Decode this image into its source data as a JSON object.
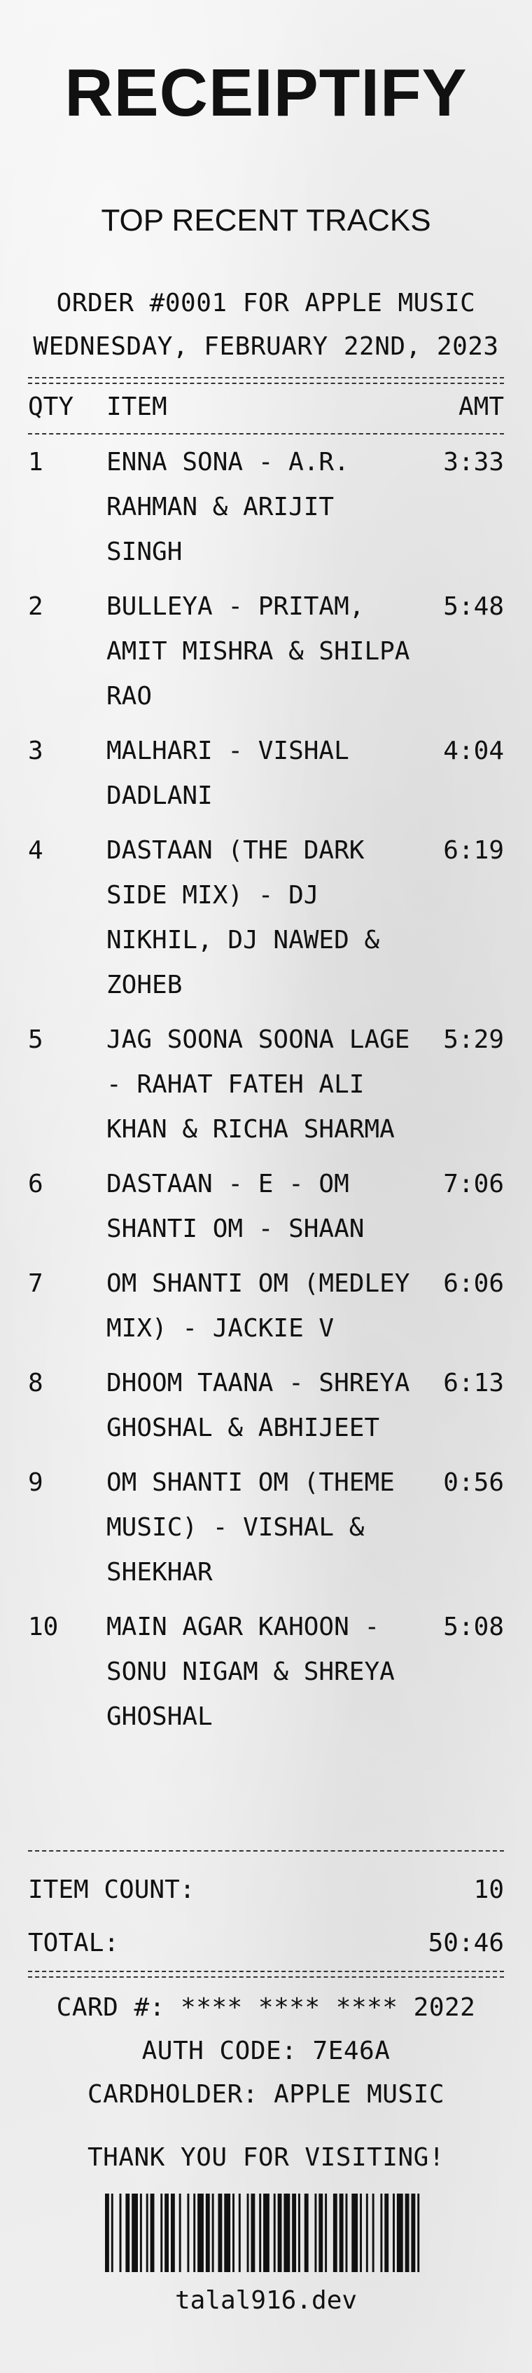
{
  "brand": "RECEIPTIFY",
  "subtitle": "TOP RECENT TRACKS",
  "order_line": "ORDER #0001 FOR APPLE MUSIC",
  "date_line": "WEDNESDAY, FEBRUARY 22ND, 2023",
  "columns": {
    "qty": "QTY",
    "item": "ITEM",
    "amt": "AMT"
  },
  "tracks": [
    {
      "qty": "1",
      "item": "ENNA SONA - A.R. RAHMAN & ARIJIT SINGH",
      "amt": "3:33"
    },
    {
      "qty": "2",
      "item": "BULLEYA - PRITAM, AMIT MISHRA & SHILPA RAO",
      "amt": "5:48"
    },
    {
      "qty": "3",
      "item": "MALHARI - VISHAL DADLANI",
      "amt": "4:04"
    },
    {
      "qty": "4",
      "item": "DASTAAN (THE DARK SIDE MIX) - DJ NIKHIL, DJ NAWED & ZOHEB",
      "amt": "6:19"
    },
    {
      "qty": "5",
      "item": "JAG SOONA SOONA LAGE - RAHAT FATEH ALI KHAN & RICHA SHARMA",
      "amt": "5:29"
    },
    {
      "qty": "6",
      "item": "DASTAAN - E - OM SHANTI OM - SHAAN",
      "amt": "7:06"
    },
    {
      "qty": "7",
      "item": "OM SHANTI OM (MEDLEY MIX) - JACKIE V",
      "amt": "6:06"
    },
    {
      "qty": "8",
      "item": "DHOOM TAANA - SHREYA GHOSHAL & ABHIJEET",
      "amt": "6:13"
    },
    {
      "qty": "9",
      "item": "OM SHANTI OM (THEME MUSIC) - VISHAL & SHEKHAR",
      "amt": "0:56"
    },
    {
      "qty": "10",
      "item": "MAIN AGAR KAHOON - SONU NIGAM & SHREYA GHOSHAL",
      "amt": "5:08"
    }
  ],
  "summary": {
    "item_count_label": "ITEM COUNT:",
    "item_count_value": "10",
    "total_label": "TOTAL:",
    "total_value": "50:46"
  },
  "card_line": "CARD #: **** **** **** 2022",
  "auth_line": "AUTH CODE: 7E46A",
  "cardholder_line": "CARDHOLDER: APPLE MUSIC",
  "thank_you": "THANK YOU FOR VISITING!",
  "footer_url": "talal916.dev",
  "icons": {
    "barcode": "barcode-icon"
  }
}
